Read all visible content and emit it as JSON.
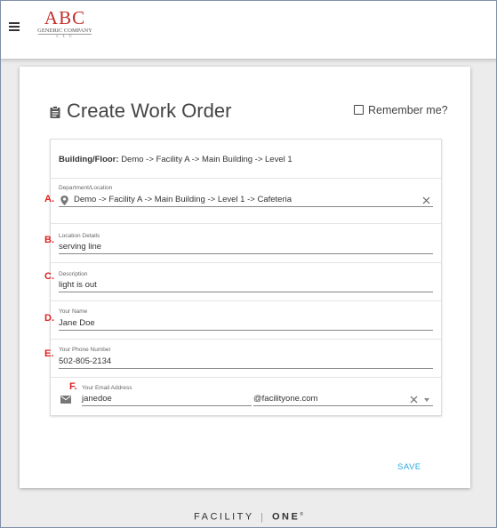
{
  "header": {
    "logo": {
      "main": "ABC",
      "sub": "GENERIC COMPANY",
      "suffix": "L L C"
    }
  },
  "form": {
    "title": "Create Work Order",
    "remember_label": "Remember me?",
    "building_label": "Building/Floor:",
    "building_value": "Demo -> Facility A -> Main Building -> Level 1",
    "department": {
      "label": "Department/Location",
      "value": "Demo -> Facility A -> Main Building -> Level 1 -> Cafeteria"
    },
    "location_details": {
      "label": "Location Details",
      "value": "serving line"
    },
    "description": {
      "label": "Description",
      "value": "light is out"
    },
    "name": {
      "label": "Your Name",
      "value": "Jane Doe"
    },
    "phone": {
      "label": "Your Phone Number",
      "value": "502-805-2134"
    },
    "email": {
      "label": "Your Email Address",
      "value": "janedoe",
      "domain": "@facilityone.com"
    },
    "save_label": "SAVE"
  },
  "markers": [
    "A.",
    "B.",
    "C.",
    "D.",
    "E.",
    "F."
  ],
  "footer": {
    "brand_left": "FACILITY",
    "brand_sep": "|",
    "brand_right": "ONE",
    "brand_mark": "®"
  },
  "colors": {
    "marker": "#e0201f",
    "save": "#29a9e0",
    "logo": "#c42d2a"
  }
}
